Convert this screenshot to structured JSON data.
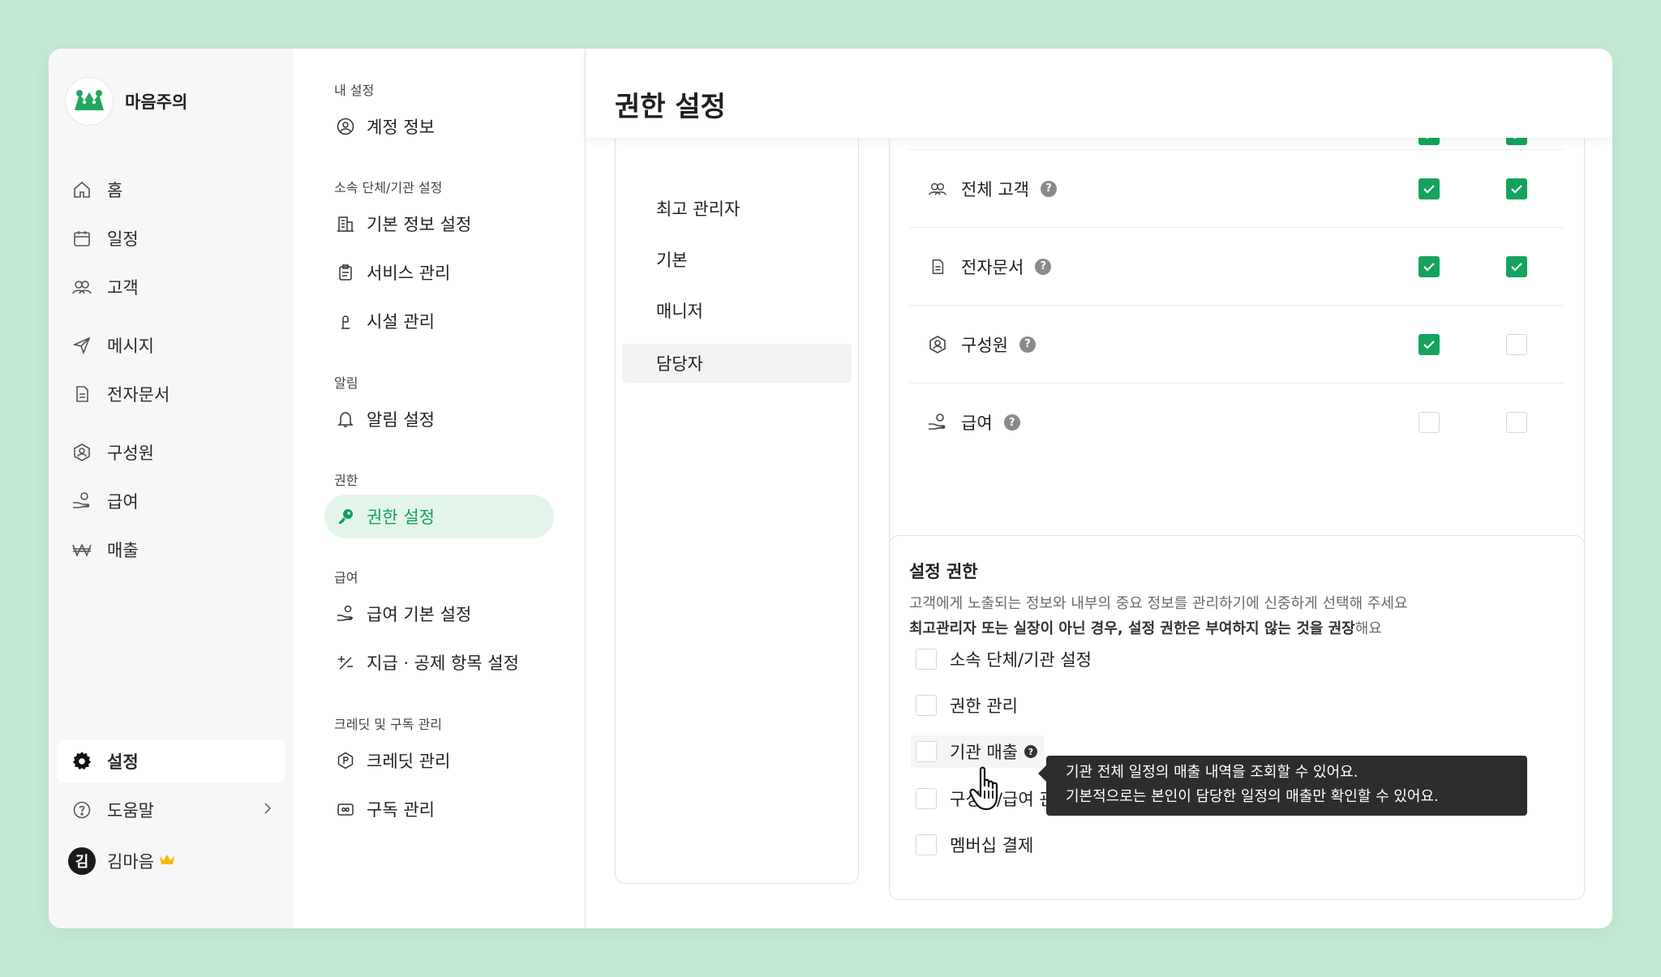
{
  "brand": {
    "name": "마음주의"
  },
  "nav": {
    "items": [
      {
        "label": "홈",
        "icon": "home-icon"
      },
      {
        "label": "일정",
        "icon": "calendar-icon"
      },
      {
        "label": "고객",
        "icon": "users-icon"
      },
      {
        "label": "메시지",
        "icon": "send-icon"
      },
      {
        "label": "전자문서",
        "icon": "document-icon"
      },
      {
        "label": "구성원",
        "icon": "member-icon"
      },
      {
        "label": "급여",
        "icon": "payroll-icon"
      },
      {
        "label": "매출",
        "icon": "won-icon"
      }
    ],
    "settings_label": "설정",
    "help_label": "도움말",
    "user_initial": "김",
    "user_name": "김마음"
  },
  "menu": {
    "sections": {
      "my": "내 설정",
      "org": "소속 단체/기관 설정",
      "alarm": "알림",
      "auth": "권한",
      "pay": "급여",
      "credit": "크레딧 및 구독 관리"
    },
    "items": {
      "account": "계정 정보",
      "basic_info": "기본 정보 설정",
      "service": "서비스 관리",
      "facility": "시설 관리",
      "alarm_settings": "알림 설정",
      "permission": "권한 설정",
      "pay_basic": "급여 기본 설정",
      "pay_items": "지급 · 공제 항목 설정",
      "credit": "크레딧 관리",
      "subscription": "구독 관리"
    }
  },
  "main": {
    "title": "권한 설정",
    "roles": [
      "최고 관리자",
      "기본",
      "매니저",
      "담당자"
    ],
    "active_role": "담당자",
    "perm_rows": [
      {
        "label": "전체 고객",
        "col1": true,
        "col2": true
      },
      {
        "label": "전자문서",
        "col1": true,
        "col2": true
      },
      {
        "label": "구성원",
        "col1": true,
        "col2": false
      },
      {
        "label": "급여",
        "col1": false,
        "col2": false
      }
    ],
    "settings": {
      "title": "설정 권한",
      "desc_line1": "고객에게 노출되는 정보와 내부의 중요 정보를 관리하기에 신중하게 선택해 주세요",
      "desc_bold": "최고관리자 또는 실장이 아닌 경우, 설정 권한은 부여하지 않는 것을 권장",
      "desc_tail": "해요",
      "options": [
        "소속 단체/기관 설정",
        "권한 관리",
        "기관 매출",
        "구성원/급여 관리",
        "멤버십 결제"
      ]
    },
    "tooltip": {
      "line1": "기관 전체 일정의 매출 내역을 조회할 수 있어요.",
      "line2": "기본적으로는 본인이 담당한 일정의 매출만 확인할 수 있어요."
    }
  },
  "colors": {
    "accent": "#14a35f",
    "bg": "#c4ead6",
    "active_menu_bg": "#e3f5eb"
  }
}
